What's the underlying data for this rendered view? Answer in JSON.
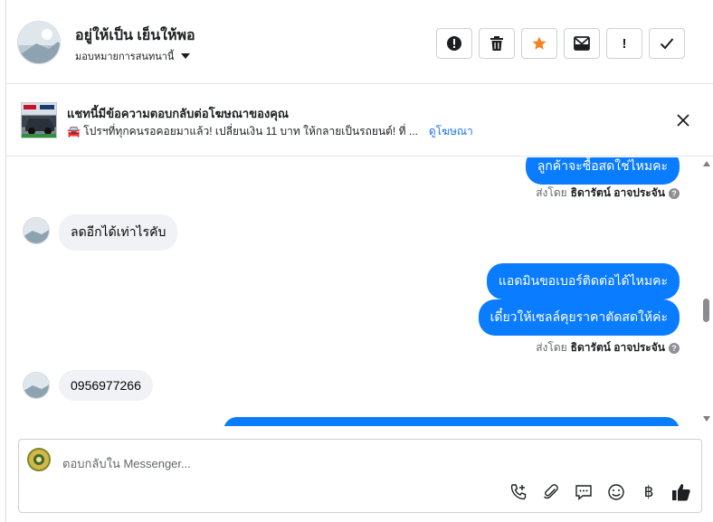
{
  "header": {
    "name": "อยู่ให้เป็น เย็นให้พอ",
    "assign_label": "มอบหมายการสนทนานี้",
    "actions": [
      {
        "icon": "alert-circle-icon"
      },
      {
        "icon": "trash-icon"
      },
      {
        "icon": "star-icon",
        "color": "#f5821f"
      },
      {
        "icon": "mark-unread-icon"
      },
      {
        "icon": "exclamation-icon",
        "label": "!"
      },
      {
        "icon": "checkmark-icon"
      }
    ]
  },
  "ad_banner": {
    "title": "แชทนี้มีข้อความตอบกลับต่อโฆษณาของคุณ",
    "text": "🚘 โปรฯที่ทุกคนรอคอยมาแล้ว! เปลี่ยนเงิน 11 บาท ให้กลายเป็นรถยนต์! ที่ ...",
    "link": "ดูโฆษณา"
  },
  "messages": [
    {
      "direction": "out",
      "text": "ลูกค้าจะซื้อสดใช่ไหมคะ"
    },
    {
      "type": "sent_by",
      "prefix": "ส่งโดย",
      "name": "ธิดารัตน์ อาจประจัน"
    },
    {
      "direction": "in",
      "text": "ลดอีกได้เท่าไรคับ"
    },
    {
      "direction": "out",
      "text": "แอดมินขอเบอร์ติดต่อได้ไหมคะ"
    },
    {
      "direction": "out",
      "text": "เดี๋ยวให้เซลล์คุยราคาตัดสดให้ค่ะ"
    },
    {
      "type": "sent_by",
      "prefix": "ส่งโดย",
      "name": "ธิดารัตน์ อาจประจัน"
    },
    {
      "direction": "in",
      "text": "0956977266"
    }
  ],
  "composer": {
    "placeholder": "ตอบกลับใน Messenger...",
    "tools": [
      "phone-plus-icon",
      "paperclip-icon",
      "chat-bubble-icon",
      "emoji-icon",
      "baht-icon",
      "thumbs-up-icon"
    ],
    "baht_symbol": "฿"
  },
  "colors": {
    "accent": "#0a7cff",
    "link": "#1877f2",
    "incoming_bubble": "#f0f2f5"
  }
}
